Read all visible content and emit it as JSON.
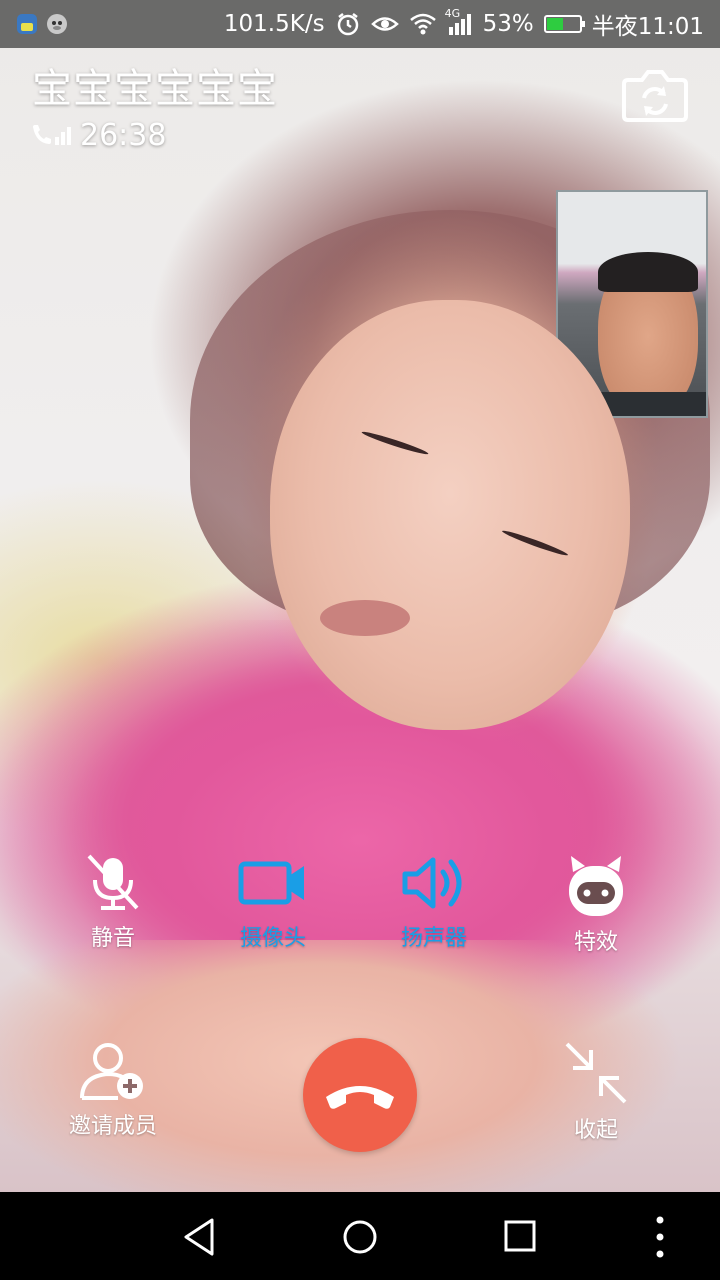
{
  "status_bar": {
    "network_speed": "101.5K/s",
    "network_type": "4G",
    "battery_percent": "53%",
    "battery_level": 0.53,
    "time": "半夜11:01",
    "icons": [
      "app-notification-icon",
      "monkey-icon",
      "alarm-icon",
      "eye-icon",
      "wifi-icon",
      "signal-icon",
      "battery-icon"
    ]
  },
  "call": {
    "caller_name": "宝宝宝宝宝宝",
    "duration": "26:38"
  },
  "controls": {
    "mute_label": "静音",
    "camera_label": "摄像头",
    "speaker_label": "扬声器",
    "effects_label": "特效",
    "invite_label": "邀请成员",
    "collapse_label": "收起"
  },
  "colors": {
    "active": "#1a9ee6",
    "inactive": "#ffffff",
    "hangup": "#f0604a"
  }
}
